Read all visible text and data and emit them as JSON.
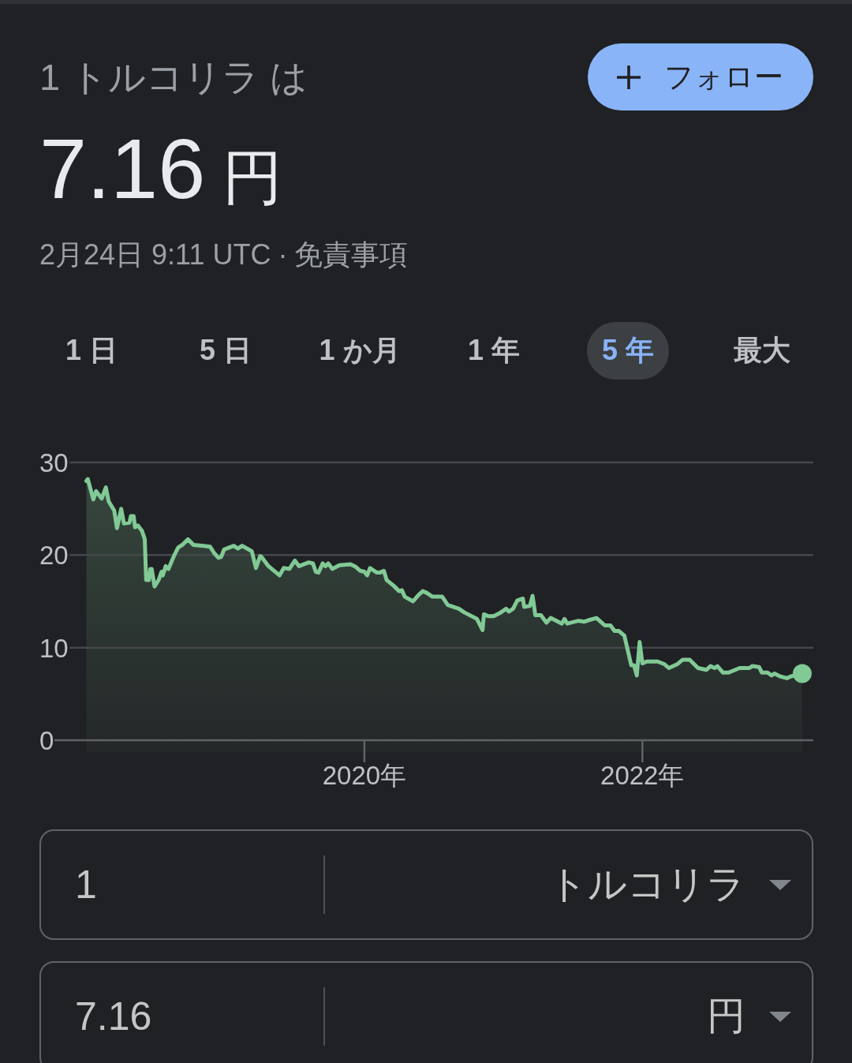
{
  "header": {
    "title": "1 トルコリラ は",
    "price": {
      "value": "7.16",
      "unit": "円"
    },
    "timestamp": "2月24日 9:11 UTC",
    "separator": "·",
    "disclaimer_link": "免責事項",
    "follow_button": {
      "label": "フォロー"
    }
  },
  "range_tabs": [
    {
      "label": "1 日",
      "selected": false
    },
    {
      "label": "5 日",
      "selected": false
    },
    {
      "label": "1 か月",
      "selected": false
    },
    {
      "label": "1 年",
      "selected": false
    },
    {
      "label": "5 年",
      "selected": true
    },
    {
      "label": "最大",
      "selected": false
    }
  ],
  "chart": {
    "chart_data": {
      "type": "area",
      "x": [
        2018.0,
        2018.01,
        2018.05,
        2018.07,
        2018.11,
        2018.14,
        2018.16,
        2018.2,
        2018.22,
        2018.25,
        2018.27,
        2018.31,
        2018.32,
        2018.34,
        2018.35,
        2018.37,
        2018.4,
        2018.42,
        2018.43,
        2018.45,
        2018.46,
        2018.47,
        2018.49,
        2018.52,
        2018.54,
        2018.55,
        2018.57,
        2018.59,
        2018.63,
        2018.66,
        2018.69,
        2018.73,
        2018.77,
        2018.83,
        2018.89,
        2018.92,
        2018.95,
        2018.97,
        2018.99,
        2019.06,
        2019.09,
        2019.12,
        2019.18,
        2019.19,
        2019.22,
        2019.25,
        2019.26,
        2019.31,
        2019.39,
        2019.42,
        2019.46,
        2019.5,
        2019.53,
        2019.6,
        2019.63,
        2019.65,
        2019.67,
        2019.7,
        2019.72,
        2019.74,
        2019.77,
        2019.82,
        2019.9,
        2019.94,
        2019.97,
        2020.0,
        2020.02,
        2020.04,
        2020.09,
        2020.11,
        2020.14,
        2020.16,
        2020.21,
        2020.25,
        2020.27,
        2020.29,
        2020.35,
        2020.39,
        2020.42,
        2020.45,
        2020.49,
        2020.56,
        2020.6,
        2020.68,
        2020.72,
        2020.81,
        2020.85,
        2020.86,
        2020.89,
        2020.93,
        2020.97,
        2021.02,
        2021.04,
        2021.07,
        2021.1,
        2021.14,
        2021.15,
        2021.19,
        2021.21,
        2021.23,
        2021.27,
        2021.31,
        2021.34,
        2021.38,
        2021.42,
        2021.44,
        2021.46,
        2021.54,
        2021.58,
        2021.62,
        2021.67,
        2021.73,
        2021.77,
        2021.8,
        2021.83,
        2021.87,
        2021.92,
        2021.94,
        2021.96,
        2021.98,
        2022.0,
        2022.03,
        2022.11,
        2022.16,
        2022.19,
        2022.25,
        2022.29,
        2022.34,
        2022.4,
        2022.46,
        2022.49,
        2022.52,
        2022.54,
        2022.58,
        2022.62,
        2022.7,
        2022.77,
        2022.79,
        2022.84,
        2022.86,
        2022.9,
        2022.93,
        2022.95,
        2022.99,
        2023.04,
        2023.07,
        2023.15
      ],
      "values": [
        28.0,
        28.2,
        26.0,
        26.9,
        26.1,
        27.3,
        25.8,
        24.8,
        22.9,
        25.0,
        23.4,
        23.5,
        24.2,
        24.2,
        23.0,
        23.2,
        22.6,
        21.7,
        17.3,
        17.3,
        18.5,
        18.5,
        16.6,
        17.3,
        18.2,
        17.8,
        18.8,
        18.5,
        19.9,
        20.8,
        21.1,
        21.7,
        21.1,
        21.0,
        20.9,
        20.2,
        19.7,
        19.8,
        20.6,
        21.0,
        20.7,
        21.0,
        20.5,
        20.4,
        18.6,
        19.9,
        19.8,
        18.8,
        17.8,
        18.6,
        18.5,
        19.4,
        18.8,
        19.2,
        19.1,
        18.2,
        18.1,
        19.1,
        18.8,
        19.1,
        18.5,
        18.9,
        19.0,
        18.7,
        18.3,
        18.2,
        17.8,
        18.6,
        18.1,
        18.1,
        18.3,
        17.3,
        16.7,
        16.1,
        16.2,
        15.5,
        15.0,
        15.7,
        16.1,
        15.9,
        15.5,
        15.5,
        14.6,
        14.2,
        13.8,
        13.1,
        11.9,
        13.6,
        13.4,
        13.4,
        13.7,
        14.2,
        13.9,
        14.2,
        15.1,
        15.3,
        14.4,
        14.5,
        15.6,
        13.5,
        13.5,
        12.7,
        13.2,
        12.9,
        12.6,
        13.1,
        12.6,
        12.9,
        12.8,
        13.0,
        13.2,
        12.4,
        12.4,
        11.8,
        11.8,
        11.3,
        8.1,
        8.1,
        7.0,
        10.6,
        8.3,
        8.5,
        8.5,
        8.2,
        7.8,
        8.2,
        8.7,
        8.7,
        7.8,
        7.6,
        8.0,
        7.8,
        8.0,
        7.3,
        7.3,
        7.8,
        7.8,
        8.0,
        7.9,
        7.3,
        7.3,
        7.0,
        7.2,
        6.9,
        6.7,
        6.9,
        7.2
      ],
      "xlim": [
        2017.77,
        2023.23
      ],
      "ylim": [
        0,
        30
      ],
      "xticks": [
        {
          "value": 2020,
          "label": "2020年"
        },
        {
          "value": 2022,
          "label": "2022年"
        }
      ],
      "yticks": [
        0,
        10,
        20,
        30
      ]
    }
  },
  "converter": [
    {
      "amount": "1",
      "currency": "トルコリラ"
    },
    {
      "amount": "7.16",
      "currency": "円"
    }
  ]
}
